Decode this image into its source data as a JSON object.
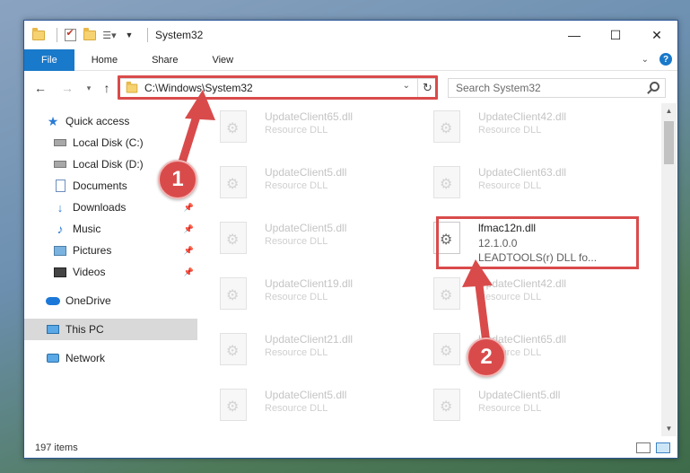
{
  "window": {
    "title": "System32",
    "controls": {
      "minimize": "—",
      "maximize": "☐",
      "close": "✕"
    }
  },
  "ribbon": {
    "tabs": [
      "File",
      "Home",
      "Share",
      "View"
    ],
    "expand": "⌄",
    "help": "?"
  },
  "address_bar": {
    "path": "C:\\Windows\\System32",
    "search_placeholder": "Search System32"
  },
  "sidebar": {
    "items": [
      {
        "label": "Quick access",
        "icon": "star-icon",
        "pinned": false
      },
      {
        "label": "Local Disk (C:)",
        "icon": "drive-icon",
        "pinned": false
      },
      {
        "label": "Local Disk (D:)",
        "icon": "drive-icon",
        "pinned": false
      },
      {
        "label": "Documents",
        "icon": "documents-icon",
        "pinned": true
      },
      {
        "label": "Downloads",
        "icon": "download-icon",
        "pinned": true
      },
      {
        "label": "Music",
        "icon": "music-icon",
        "pinned": true
      },
      {
        "label": "Pictures",
        "icon": "pictures-icon",
        "pinned": true
      },
      {
        "label": "Videos",
        "icon": "videos-icon",
        "pinned": true
      },
      {
        "label": "OneDrive",
        "icon": "cloud-icon",
        "pinned": false
      },
      {
        "label": "This PC",
        "icon": "computer-icon",
        "pinned": false,
        "selected": true
      },
      {
        "label": "Network",
        "icon": "network-icon",
        "pinned": false
      }
    ]
  },
  "files": {
    "left": [
      {
        "name": "UpdateClient65.dll",
        "desc": "Resource DLL"
      },
      {
        "name": "UpdateClient5.dll",
        "desc": "Resource DLL"
      },
      {
        "name": "UpdateClient5.dll",
        "desc": "Resource DLL"
      },
      {
        "name": "UpdateClient19.dll",
        "desc": "Resource DLL"
      },
      {
        "name": "UpdateClient21.dll",
        "desc": "Resource DLL"
      },
      {
        "name": "UpdateClient5.dll",
        "desc": "Resource DLL"
      }
    ],
    "right": [
      {
        "name": "UpdateClient42.dll",
        "desc": "Resource DLL"
      },
      {
        "name": "UpdateClient63.dll",
        "desc": "Resource DLL"
      },
      {
        "name": "UpdateClient42.dll",
        "desc": "Resource DLL"
      },
      {
        "name": "UpdateClient65.dll",
        "desc": "Resource DLL"
      },
      {
        "name": "UpdateClient5.dll",
        "desc": "Resource DLL"
      }
    ],
    "highlighted": {
      "name": "lfmac12n.dll",
      "version": "12.1.0.0",
      "desc": "LEADTOOLS(r) DLL fo..."
    }
  },
  "status": {
    "item_count": "197 items"
  },
  "annotations": {
    "markers": [
      "1",
      "2"
    ],
    "color": "#d94b4b"
  }
}
